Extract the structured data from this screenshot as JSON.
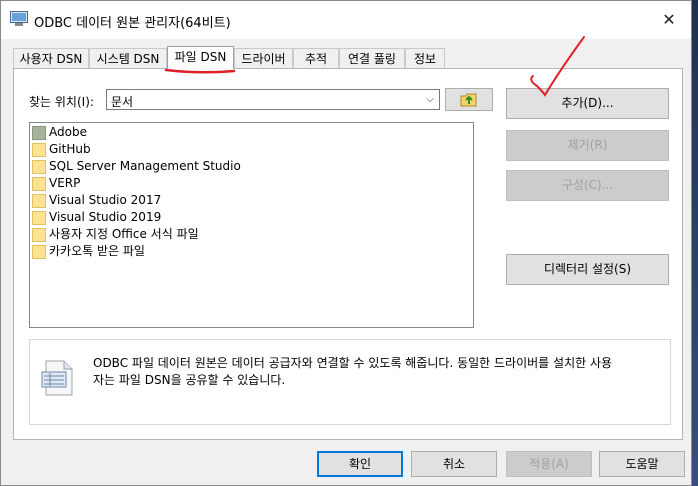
{
  "window": {
    "title": "ODBC 데이터 원본 관리자(64비트)",
    "close_glyph": "✕"
  },
  "tabs": [
    {
      "label": "사용자 DSN"
    },
    {
      "label": "시스템 DSN"
    },
    {
      "label": "파일 DSN",
      "active": true
    },
    {
      "label": "드라이버"
    },
    {
      "label": "추적"
    },
    {
      "label": "연결 풀링"
    },
    {
      "label": "정보"
    }
  ],
  "lookin": {
    "label": "찾는 위치(I):",
    "value": "문서"
  },
  "files": [
    {
      "name": "Adobe",
      "icon": "folder-shaded-icon"
    },
    {
      "name": "GitHub",
      "icon": "folder-icon"
    },
    {
      "name": "SQL Server Management Studio",
      "icon": "folder-icon"
    },
    {
      "name": "VERP",
      "icon": "folder-icon"
    },
    {
      "name": "Visual Studio 2017",
      "icon": "folder-icon"
    },
    {
      "name": "Visual Studio 2019",
      "icon": "folder-icon"
    },
    {
      "name": "사용자 지정 Office 서식 파일",
      "icon": "folder-icon"
    },
    {
      "name": "카카오톡 받은 파일",
      "icon": "folder-icon"
    }
  ],
  "buttons": {
    "add": "추가(D)...",
    "remove": "제거(R)",
    "configure": "구성(C)...",
    "set_directory": "디렉터리 설정(S)"
  },
  "info": {
    "line1": "ODBC 파일 데이터 원본은 데이터 공급자와 연결할 수 있도록 해줍니다. 동일한 드라이버를 설치한 사용",
    "line2": "자는 파일 DSN을 공유할 수 있습니다."
  },
  "footer": {
    "ok": "확인",
    "cancel": "취소",
    "apply": "적용(A)",
    "help": "도움말"
  },
  "colors": {
    "annotation": "#e0202a",
    "accent": "#0078d7"
  }
}
